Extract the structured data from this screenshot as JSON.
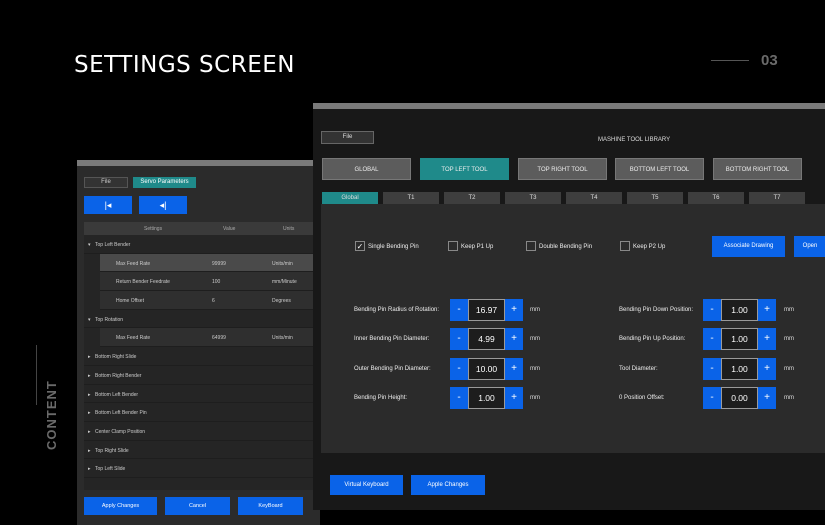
{
  "page": {
    "title": "SETTINGS SCREEN",
    "number": "03",
    "side_label": "CONTENT"
  },
  "back_window": {
    "file_label": "File",
    "servo_tab": "Servo Parameters",
    "icon_buttons": [
      "|◂",
      "◂|"
    ],
    "columns": [
      "Settings",
      "Value",
      "Units"
    ],
    "rows": [
      {
        "label": "Top Left Bender",
        "value": "",
        "unit": "",
        "level": 0,
        "expander": "▾"
      },
      {
        "label": "Max Feed Rate",
        "value": "99999",
        "unit": "Units/min",
        "level": 1,
        "expander": ""
      },
      {
        "label": "Return Bender Feedrate",
        "value": "100",
        "unit": "mm/Minute",
        "level": 1,
        "expander": ""
      },
      {
        "label": "Home Offset",
        "value": "6",
        "unit": "Degrees",
        "level": 1,
        "expander": ""
      },
      {
        "label": "Top Rotation",
        "value": "",
        "unit": "",
        "level": 0,
        "expander": "▾"
      },
      {
        "label": "Max Feed Rate",
        "value": "64999",
        "unit": "Units/min",
        "level": 1,
        "expander": ""
      },
      {
        "label": "Bottom Right Slide",
        "value": "",
        "unit": "",
        "level": 0,
        "expander": "▸"
      },
      {
        "label": "Bottom Right Bender",
        "value": "",
        "unit": "",
        "level": 0,
        "expander": "▸"
      },
      {
        "label": "Bottom Left Bender",
        "value": "",
        "unit": "",
        "level": 0,
        "expander": "▸"
      },
      {
        "label": "Bottom Left Bender Pin",
        "value": "",
        "unit": "",
        "level": 0,
        "expander": "▸"
      },
      {
        "label": "Center Clamp Position",
        "value": "",
        "unit": "",
        "level": 0,
        "expander": "▸"
      },
      {
        "label": "Top Right Slide",
        "value": "",
        "unit": "",
        "level": 0,
        "expander": "▸"
      },
      {
        "label": "Top Left Slide",
        "value": "",
        "unit": "",
        "level": 0,
        "expander": "▸"
      }
    ],
    "buttons": {
      "apply": "Apply Changes",
      "cancel": "Cancel",
      "keyboard": "KeyBoard"
    }
  },
  "front_window": {
    "file_label": "File",
    "title": "MASHINE TOOL LIBRARY",
    "tool_tabs": [
      "GLOBAL",
      "TOP LEFT TOOL",
      "TOP RIGHT TOOL",
      "BOTTOM LEFT TOOL",
      "BOTTOM RIGHT TOOL"
    ],
    "active_tool_tab": "TOP LEFT TOOL",
    "t_tabs": [
      "Global",
      "T1",
      "T2",
      "T3",
      "T4",
      "T5",
      "T6",
      "T7"
    ],
    "active_t_tab": "Global",
    "checkboxes": [
      {
        "label": "Single Bending Pin",
        "checked": true,
        "check_mark": "✓"
      },
      {
        "label": "Keep P1 Up",
        "checked": false,
        "check_mark": ""
      },
      {
        "label": "Double Bending Pin",
        "checked": false,
        "check_mark": ""
      },
      {
        "label": "Keep P2 Up",
        "checked": false,
        "check_mark": ""
      }
    ],
    "action_buttons": {
      "associate": "Associate Drawing",
      "open": "Open"
    },
    "left_fields": [
      {
        "label": "Bending Pin Radius of Rotation:",
        "value": "16.97",
        "unit": "mm"
      },
      {
        "label": "Inner Bending Pin Diameter:",
        "value": "4.99",
        "unit": "mm"
      },
      {
        "label": "Outer Bending Pin Diameter:",
        "value": "10.00",
        "unit": "mm"
      },
      {
        "label": "Bending Pin Height:",
        "value": "1.00",
        "unit": "mm"
      }
    ],
    "right_fields": [
      {
        "label": "Bending Pin Down Position:",
        "value": "1.00",
        "unit": "mm"
      },
      {
        "label": "Bending Pin Up Position:",
        "value": "1.00",
        "unit": "mm"
      },
      {
        "label": "Tool Diameter:",
        "value": "1.00",
        "unit": "mm"
      },
      {
        "label": "0 Position Offset:",
        "value": "0.00",
        "unit": "mm"
      }
    ],
    "stepper_symbols": {
      "minus": "-",
      "plus": "+"
    },
    "bottom_buttons": {
      "virtual_keyboard": "Virtual Keyboard",
      "apply": "Apple Changes"
    }
  },
  "colors": {
    "accent_blue": "#0a63e8",
    "teal": "#1f8a8a",
    "background": "#000000"
  }
}
